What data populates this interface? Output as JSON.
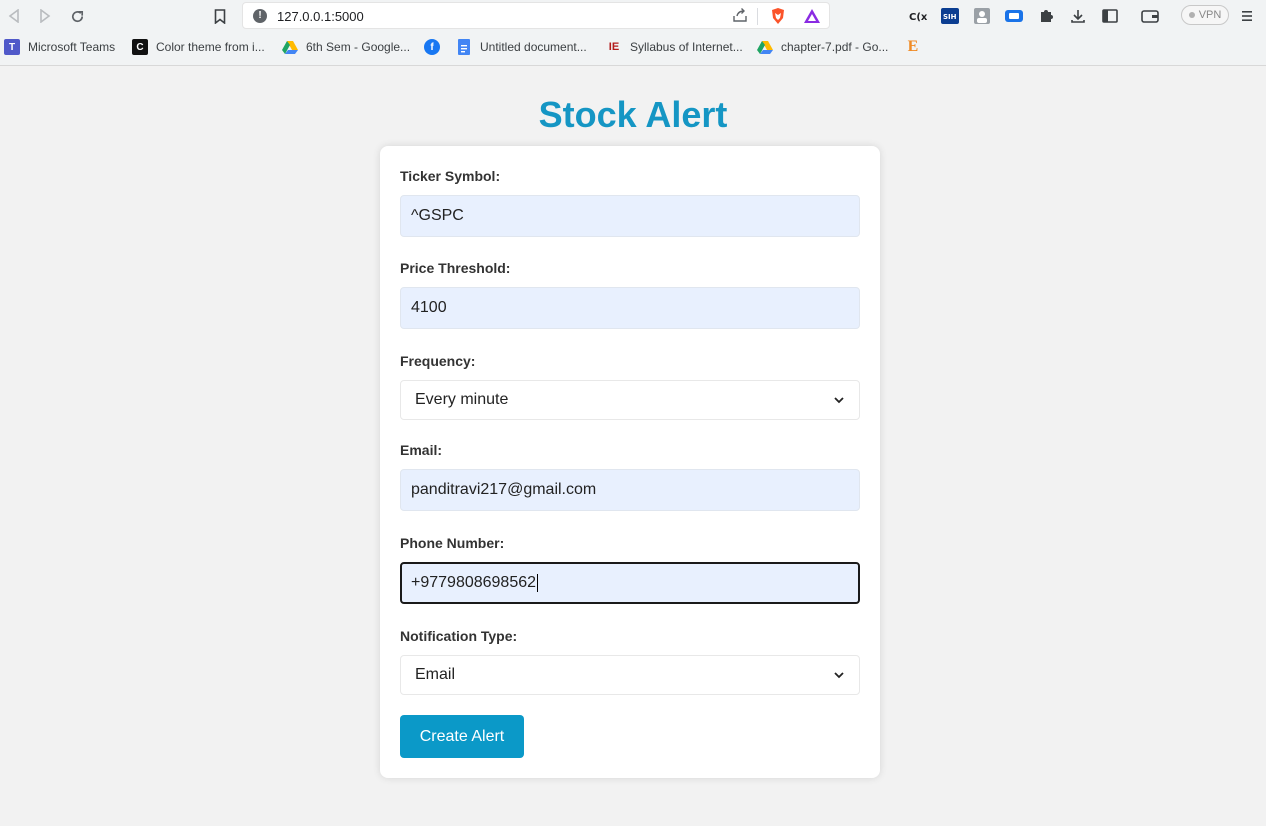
{
  "browser": {
    "url": "127.0.0.1:5000",
    "vpn_label": "VPN",
    "bookmarks": [
      {
        "label": "Microsoft Teams",
        "icon": "teams-icon",
        "color": "#5059c9"
      },
      {
        "label": "Color theme from i...",
        "icon": "color-theme-icon",
        "color": "#111111"
      },
      {
        "label": "6th Sem - Google...",
        "icon": "google-drive-icon",
        "color": "#1fa463"
      },
      {
        "label": "",
        "icon": "facebook-icon",
        "color": "#1877f2"
      },
      {
        "label": "Untitled document...",
        "icon": "google-docs-icon",
        "color": "#4285f4"
      },
      {
        "label": "Syllabus of Internet...",
        "icon": "ioe-icon",
        "color": "#b31b1b"
      },
      {
        "label": "chapter-7.pdf - Go...",
        "icon": "google-drive-icon",
        "color": "#1fa463"
      },
      {
        "label": "",
        "icon": "e-icon",
        "color": "#f08a24"
      }
    ]
  },
  "page": {
    "title": "Stock Alert",
    "accent": "#1596c4",
    "form": {
      "ticker_label": "Ticker Symbol:",
      "ticker_value": "^GSPC",
      "threshold_label": "Price Threshold:",
      "threshold_value": "4100",
      "frequency_label": "Frequency:",
      "frequency_value": "Every minute",
      "email_label": "Email:",
      "email_value": "panditravi217@gmail.com",
      "phone_label": "Phone Number:",
      "phone_value": "+9779808698562",
      "notification_label": "Notification Type:",
      "notification_value": "Email",
      "submit_label": "Create Alert"
    }
  }
}
